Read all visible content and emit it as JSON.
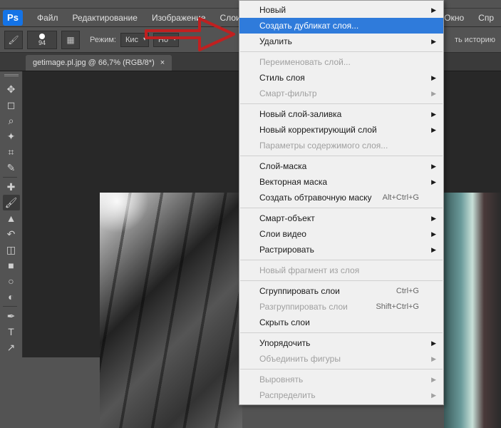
{
  "logo": "Ps",
  "menubar": [
    "Файл",
    "Редактирование",
    "Изображение",
    "Слои"
  ],
  "menubar_right": [
    "Окно",
    "Спр"
  ],
  "options": {
    "brush_size": "94",
    "mode_label": "Режим:",
    "mode_value": "Кис",
    "opacity_value": "Но",
    "history_btn": "ть историю"
  },
  "tab": {
    "title": "getimage.pl.jpg @ 66,7% (RGB/8*)",
    "close": "×"
  },
  "context_menu": [
    {
      "type": "item",
      "label": "Новый",
      "arrow": true
    },
    {
      "type": "item",
      "label": "Создать дубликат слоя...",
      "highlighted": true
    },
    {
      "type": "item",
      "label": "Удалить",
      "arrow": true
    },
    {
      "type": "sep"
    },
    {
      "type": "item",
      "label": "Переименовать слой...",
      "disabled": true
    },
    {
      "type": "item",
      "label": "Стиль слоя",
      "arrow": true
    },
    {
      "type": "item",
      "label": "Смарт-фильтр",
      "arrow": true,
      "disabled": true
    },
    {
      "type": "sep"
    },
    {
      "type": "item",
      "label": "Новый слой-заливка",
      "arrow": true
    },
    {
      "type": "item",
      "label": "Новый корректирующий слой",
      "arrow": true
    },
    {
      "type": "item",
      "label": "Параметры содержимого слоя...",
      "disabled": true
    },
    {
      "type": "sep"
    },
    {
      "type": "item",
      "label": "Слой-маска",
      "arrow": true
    },
    {
      "type": "item",
      "label": "Векторная маска",
      "arrow": true
    },
    {
      "type": "item",
      "label": "Создать обтравочную маску",
      "shortcut": "Alt+Ctrl+G"
    },
    {
      "type": "sep"
    },
    {
      "type": "item",
      "label": "Смарт-объект",
      "arrow": true
    },
    {
      "type": "item",
      "label": "Слои видео",
      "arrow": true
    },
    {
      "type": "item",
      "label": "Растрировать",
      "arrow": true
    },
    {
      "type": "sep"
    },
    {
      "type": "item",
      "label": "Новый фрагмент из слоя",
      "disabled": true
    },
    {
      "type": "sep"
    },
    {
      "type": "item",
      "label": "Сгруппировать слои",
      "shortcut": "Ctrl+G"
    },
    {
      "type": "item",
      "label": "Разгруппировать слои",
      "shortcut": "Shift+Ctrl+G",
      "disabled": true
    },
    {
      "type": "item",
      "label": "Скрыть слои"
    },
    {
      "type": "sep"
    },
    {
      "type": "item",
      "label": "Упорядочить",
      "arrow": true
    },
    {
      "type": "item",
      "label": "Объединить фигуры",
      "arrow": true,
      "disabled": true
    },
    {
      "type": "sep"
    },
    {
      "type": "item",
      "label": "Выровнять",
      "arrow": true,
      "disabled": true
    },
    {
      "type": "item",
      "label": "Распределить",
      "arrow": true,
      "disabled": true
    }
  ],
  "tools": [
    {
      "name": "move-tool",
      "glyph": "✥"
    },
    {
      "name": "marquee-tool",
      "glyph": "◻"
    },
    {
      "name": "lasso-tool",
      "glyph": "⌕"
    },
    {
      "name": "wand-tool",
      "glyph": "✦"
    },
    {
      "name": "crop-tool",
      "glyph": "⌗"
    },
    {
      "name": "eyedropper-tool",
      "glyph": "✎"
    },
    {
      "name": "healing-tool",
      "glyph": "✚"
    },
    {
      "name": "brush-tool",
      "glyph": "🖌",
      "active": true
    },
    {
      "name": "stamp-tool",
      "glyph": "▲"
    },
    {
      "name": "history-brush-tool",
      "glyph": "↶"
    },
    {
      "name": "eraser-tool",
      "glyph": "◫"
    },
    {
      "name": "gradient-tool",
      "glyph": "■"
    },
    {
      "name": "blur-tool",
      "glyph": "○"
    },
    {
      "name": "dodge-tool",
      "glyph": "◐"
    },
    {
      "name": "pen-tool",
      "glyph": "✒"
    },
    {
      "name": "type-tool",
      "glyph": "T"
    },
    {
      "name": "path-tool",
      "glyph": "↗"
    }
  ]
}
